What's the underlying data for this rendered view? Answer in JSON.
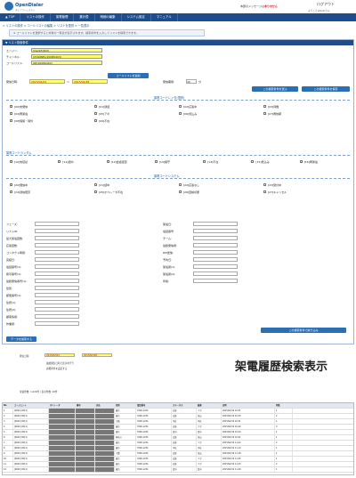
{
  "header": {
    "brand": "OpenDialer",
    "brand_sub": "ダイアラーシステム",
    "notice_prefix": "本部のメッセージは",
    "notice_suffix": "ありません",
    "logout": "ログアウト",
    "user": "ようこそadminさん"
  },
  "nav": [
    "▲ TOP",
    "リストの操作",
    "架電管理",
    "集計表",
    "明細の編集",
    "システム設定",
    "マニュアル"
  ],
  "breadcrumb": "> リストの操作 > コールリストの編集 > リストを選択 > 一覧表示",
  "hint": "※ コールリストを選択すると対象の一覧表が表示されます。検索条件を入力してリストを検索できます。",
  "panel_title": "▼ リスト検索条件",
  "form": {
    "agent_label": "エンジン:",
    "agent_value": "Client3(0UI)",
    "channel_label": "チャンネル:",
    "channel_value": "CHANNEL(20080403)",
    "list_label": "コールリスト:",
    "list_value": "OP(20080404)",
    "add_btn": "コールリストを追加",
    "date_label": "発信日時:",
    "date_from": "2015/02/01",
    "date_to": "2015/02/28",
    "period_label": "発信期間:",
    "period_value": "40",
    "period_unit": "分",
    "clear_btn": "この検索条件を選ぶ",
    "save_btn": "この検索条件を保存"
  },
  "sec1": "架電コードレンタ(選択)",
  "codes1": [
    "[00]未発信",
    "[01]通話",
    "[02]応答中",
    "[03]待機",
    "[04]再架電",
    "[05]アポ",
    "[06]見込み",
    "[07]再依頼",
    "[08]保留・除外",
    "[09]不在"
  ],
  "sec2": "架電コードランダム",
  "codes2": [
    "[10]未接続",
    "[11]話中",
    "[12]会話拒否",
    "[13]留守",
    "[14]不在",
    "[15]見込み",
    "[16]再架電"
  ],
  "sec3": "架電コードシステム",
  "codes3": [
    "[20]発信中",
    "[21]話中",
    "[22]応答なし",
    "[23]受付中",
    "[24]通信障害",
    "[25]オペレータ不在",
    "[26]回線切断",
    "[27]キャンセル"
  ],
  "fields": [
    "フェーズ:",
    "リストID:",
    "最大架電回数:",
    "応答回数:",
    "コンタクト時間:",
    "完結日:",
    "電話番号(1):",
    "携帯番号(1):",
    "最終発信番号(1):",
    "性別:",
    "郵便番号(1):",
    "住所(1):",
    "住所(2):",
    "顧客情報:",
    "作業者:"
  ],
  "fields_r": [
    "架電日:",
    "電話番号:",
    "チーム:",
    "最終発信者:",
    "DM送信:",
    "予約日:",
    "架電者(1):",
    "架電者(2):",
    "年齢:"
  ],
  "list_btn": "この検索条件で絞り込み",
  "run_btn": "データを検索する",
  "result": {
    "date_label": "発信日時:",
    "date_from": "2015/02/01",
    "date_to": "2015/02/28",
    "note1": "最終発信日時で表示を行う",
    "note2": "詳細条件を設定する",
    "extra": "架電件数: 1,024件 / 表示件数: 20件"
  },
  "tag": "架電履歴検索表示",
  "grid_headers": [
    "No",
    "エージェント",
    "オペレータ",
    "番号",
    "氏名",
    "住所",
    "電話番号",
    "ステータス",
    "結果",
    "日時",
    "件数"
  ],
  "grid_rows": [
    [
      "1",
      "[0001] OP(1)",
      "",
      "",
      "",
      "東京",
      "Y090-1234",
      "応答",
      "アポ",
      "2015/02/12 10:21",
      "1"
    ],
    [
      "2",
      "[0001] OP(1)",
      "",
      "",
      "",
      "東京",
      "Y090-1234",
      "応答",
      "見込",
      "2015/02/12 10:25",
      "2"
    ],
    [
      "3",
      "[0001] OP(1)",
      "",
      "",
      "",
      "大阪",
      "Y090-1234",
      "不在",
      "不在",
      "2015/02/12 10:31",
      "1"
    ],
    [
      "4",
      "[0001] OP(1)",
      "",
      "",
      "",
      "東京",
      "Y090-1234",
      "応答",
      "アポ",
      "2015/02/12 10:40",
      "3"
    ],
    [
      "5",
      "[0001] OP(1)",
      "",
      "",
      "",
      "東京",
      "Y090-1234",
      "話中",
      "話中",
      "2015/02/12 10:44",
      "1"
    ],
    [
      "6",
      "[0001] OP(1)",
      "",
      "",
      "",
      "神奈川",
      "Y090-1234",
      "応答",
      "見込",
      "2015/02/12 10:51",
      "1"
    ],
    [
      "7",
      "[0001] OP(1)",
      "",
      "",
      "",
      "東京",
      "Y090-1234",
      "応答",
      "アポ",
      "2015/02/12 11:02",
      "2"
    ],
    [
      "8",
      "[0001] OP(1)",
      "",
      "",
      "",
      "東京",
      "Y090-1234",
      "不在",
      "不在",
      "2015/02/12 11:10",
      "1"
    ],
    [
      "9",
      "[0001] OP(1)",
      "",
      "",
      "",
      "千葉",
      "Y090-1234",
      "応答",
      "見込",
      "2015/02/12 11:18",
      "1"
    ],
    [
      "10",
      "[0001] OP(1)",
      "",
      "",
      "",
      "東京",
      "Y090-1234",
      "応答",
      "アポ",
      "2015/02/12 11:25",
      "1"
    ],
    [
      "11",
      "[0001] OP(1)",
      "",
      "",
      "",
      "東京",
      "Y090-1234",
      "応答",
      "アポ",
      "2015/02/12 11:33",
      "2"
    ],
    [
      "12",
      "[0001] OP(1)",
      "",
      "",
      "",
      "東京",
      "Y090-1234",
      "話中",
      "話中",
      "2015/02/12 11:40",
      "1"
    ]
  ],
  "colors": {
    "nav": "#1d4d8c",
    "highlight": "#ffff66"
  }
}
